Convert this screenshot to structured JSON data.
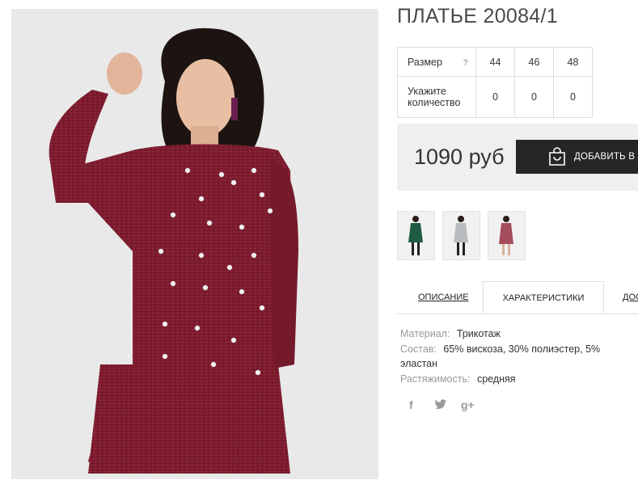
{
  "product": {
    "title": "ПЛАТЬЕ 20084/1"
  },
  "size_table": {
    "size_label": "Размер",
    "help_mark": "?",
    "sizes": [
      "44",
      "46",
      "48"
    ],
    "qty_label_line1": "Укажите",
    "qty_label_line2": "количество",
    "quantities": [
      "0",
      "0",
      "0"
    ]
  },
  "purchase": {
    "price": "1090 руб",
    "add_to_cart_label": "ДОБАВИТЬ В З"
  },
  "thumbnails": [
    {
      "name": "green-dress",
      "color": "#1f5b43"
    },
    {
      "name": "grey-dress",
      "color": "#b9bcbf"
    },
    {
      "name": "burgundy-dress",
      "color": "#a44d5c"
    }
  ],
  "tabs": [
    {
      "label": "ОПИСАНИЕ"
    },
    {
      "label": "ХАРАКТЕРИСТИКИ"
    },
    {
      "label": "ДОС"
    }
  ],
  "characteristics": [
    {
      "key": "Материал:",
      "value": "Трикотаж"
    },
    {
      "key": "Состав:",
      "value": "65% вискоза, 30% полиэстер, 5% эластан"
    },
    {
      "key": "Растяжимость:",
      "value": "средняя"
    }
  ],
  "social": {
    "facebook": "f",
    "google_plus": "g+"
  },
  "colors": {
    "dress": "#7e1d2f",
    "photo_background": "#e9e9ea",
    "cart_button": "#262626",
    "price_box": "#efefef"
  }
}
